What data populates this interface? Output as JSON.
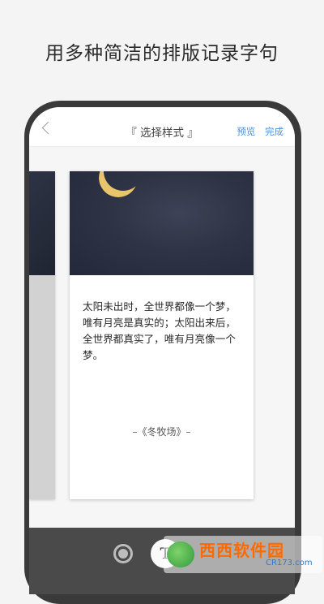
{
  "headline": "用多种简洁的排版记录字句",
  "toolbar": {
    "title": "『 选择样式 』",
    "preview_label": "预览",
    "done_label": "完成"
  },
  "card": {
    "quote": "太阳未出时，全世界都像一个梦，唯有月亮是真实的；太阳出来后，全世界都真实了，唯有月亮像一个梦。",
    "source": "–《冬牧场》–"
  },
  "bottom_bar": {
    "text_style_label": "T"
  },
  "watermark": {
    "main": "西西软件园",
    "sub": "CR173.com"
  },
  "colors": {
    "accent": "#4e8fd6",
    "phone_frame": "#3a3a3a",
    "night_sky": "#2e3345",
    "moon": "#e8c56a"
  },
  "icons": {
    "back": "chevron-left-icon",
    "moon": "crescent-moon-icon",
    "style": "circle-style-icon"
  }
}
